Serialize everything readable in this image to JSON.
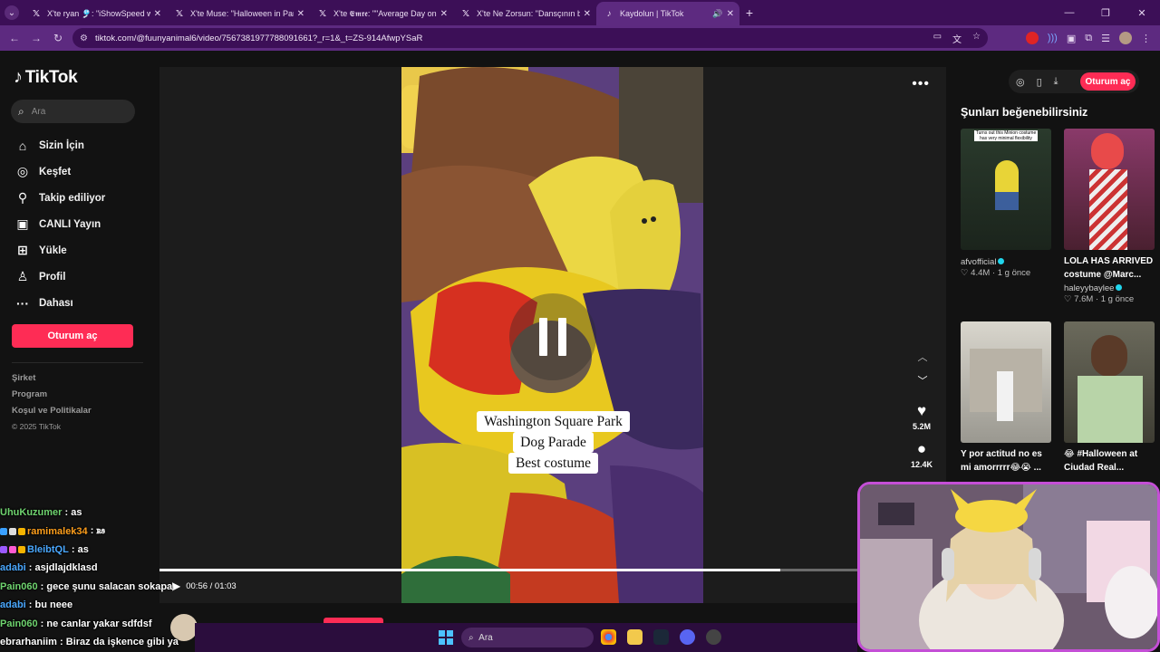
{
  "browser": {
    "tabs": [
      {
        "icon": "x-icon",
        "title": "X'te ryan 🎐: \"iShowSpeed wen...",
        "active": false
      },
      {
        "icon": "x-icon",
        "title": "X'te Muse: \"Halloween in Paris 🎃",
        "active": false
      },
      {
        "icon": "x-icon",
        "title": "X'te 𝕰𝖒𝖗𝖊: \"\"Average Day on th...",
        "active": false
      },
      {
        "icon": "x-icon",
        "title": "X'te Ne Zorsun: \"Dansçının bek...",
        "active": false
      },
      {
        "icon": "tiktok-icon",
        "title": "Kaydolun | TikTok",
        "active": true
      }
    ],
    "url": "tiktok.com/@fuunyanimal6/video/7567381977788091661?_r=1&_t=ZS-914AfwpYSaR"
  },
  "tiktok": {
    "logo_text": "TikTok",
    "search_placeholder": "Ara",
    "nav": [
      {
        "icon": "home-icon",
        "label": "Sizin İçin"
      },
      {
        "icon": "compass-icon",
        "label": "Keşfet"
      },
      {
        "icon": "following-icon",
        "label": "Takip ediliyor"
      },
      {
        "icon": "live-icon",
        "label": "CANLI Yayın"
      },
      {
        "icon": "upload-icon",
        "label": "Yükle"
      },
      {
        "icon": "profile-icon",
        "label": "Profil"
      },
      {
        "icon": "more-icon",
        "label": "Dahası"
      }
    ],
    "login_label": "Oturum aç",
    "footer": {
      "company": "Şirket",
      "program": "Program",
      "terms": "Koşul ve Politikalar",
      "copyright": "© 2025 TikTok"
    },
    "video": {
      "caption": [
        "Washington Square Park",
        "Dog Parade",
        "Best costume"
      ],
      "likes": "5.2M",
      "comments": "12.4K",
      "time": "00:56 / 01:03",
      "progress": 0.89,
      "author": "fuunyanimal6"
    },
    "top_login_label": "Oturum aç",
    "recommendations_title": "Şunları beğenebilirsiniz",
    "recommendations": [
      {
        "title": "",
        "user": "afvofficial",
        "likes": "4.4M",
        "age": "1 g önce",
        "thumb_text": "Turns out this Minion costume has very minimal flexibility",
        "colors": [
          "#2a3a2c",
          "#e8d437"
        ]
      },
      {
        "title": "LOLA HAS ARRIVED costume @Marc...",
        "user": "haleyybaylee",
        "likes": "7.6M",
        "age": "1 g önce",
        "colors": [
          "#8a3a6a",
          "#e84a4a"
        ]
      },
      {
        "title": "Y por actitud no es mi amorrrrr😂😭 ...",
        "user": "",
        "likes": "",
        "age": "",
        "colors": [
          "#c9c6bd",
          "#7a7a78"
        ]
      },
      {
        "title": "😂 #Halloween at Ciudad Real...",
        "user": "",
        "likes": "",
        "age": "",
        "colors": [
          "#5d5b4d",
          "#a8c8a0"
        ]
      }
    ]
  },
  "chat": [
    {
      "user": "UhuKuzumer",
      "message": ": as",
      "color": "#6fd36f"
    },
    {
      "user": "ramimalek34",
      "message": ": ꭱꭶ",
      "color": "#ff9f1c"
    },
    {
      "user": "BleibtQL",
      "message": ": as",
      "color": "#4aa8ff"
    },
    {
      "user": "adabi",
      "message": ": asjdlajdklasd",
      "color": "#4aa8ff"
    },
    {
      "user": "Pain060",
      "message": ": gece şunu salacan sokapa",
      "color": "#6fd36f"
    },
    {
      "user": "adabi",
      "message": ": bu neee",
      "color": "#4aa8ff"
    },
    {
      "user": "Pain060",
      "message": ": ne canlar yakar sdfdsf",
      "color": "#6fd36f"
    },
    {
      "user": "ebrarhaniim",
      "message": ": Biraz da işkence gibi ya",
      "color": "#ffffff"
    }
  ],
  "taskbar": {
    "search_placeholder": "Ara"
  },
  "colors": {
    "tiktok_red": "#fe2c55",
    "browser_tab_bg": "#3c0f57",
    "browser_toolbar": "#5d2a80"
  }
}
